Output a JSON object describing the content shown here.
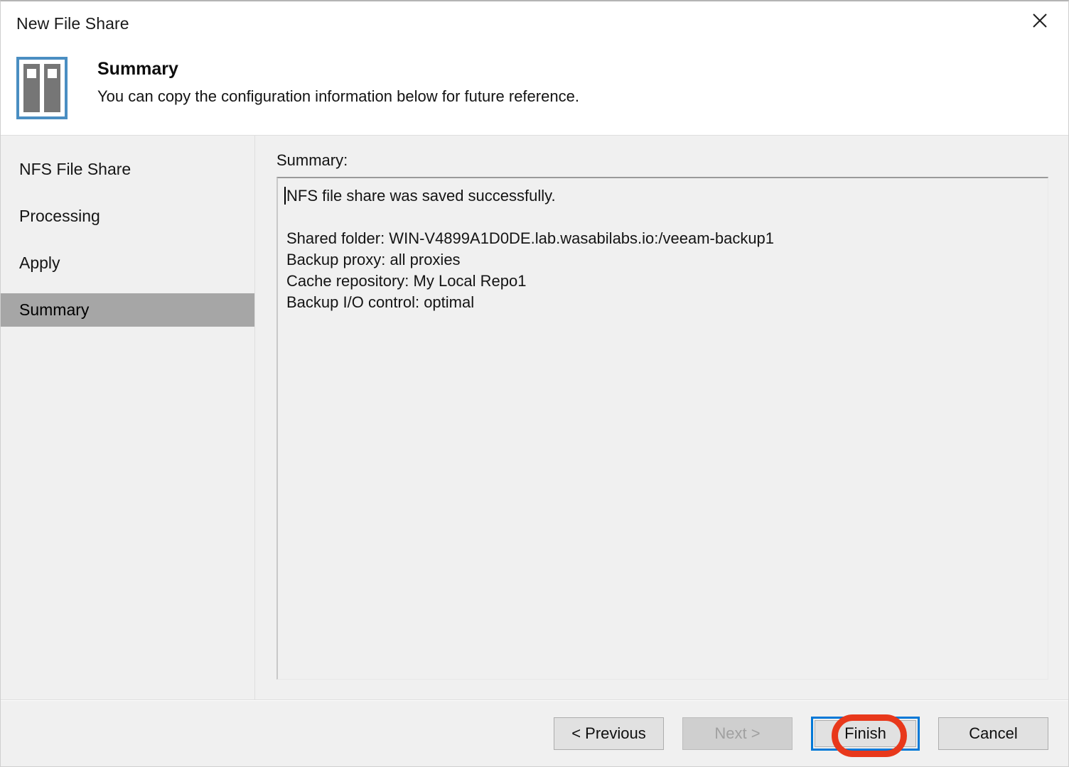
{
  "window": {
    "title": "New File Share",
    "close_icon": "close-icon"
  },
  "header": {
    "icon": "file-share-icon",
    "title": "Summary",
    "subtitle": "You can copy the configuration information below for future reference."
  },
  "sidebar": {
    "items": [
      {
        "label": "NFS File Share",
        "selected": false
      },
      {
        "label": "Processing",
        "selected": false
      },
      {
        "label": "Apply",
        "selected": false
      },
      {
        "label": "Summary",
        "selected": true
      }
    ]
  },
  "content": {
    "summary_label": "Summary:",
    "summary_lines": [
      "NFS file share was saved successfully.",
      "",
      "Shared folder: WIN-V4899A1D0DE.lab.wasabilabs.io:/veeam-backup1",
      "Backup proxy: all proxies",
      "Cache repository: My Local Repo1",
      "Backup I/O control: optimal"
    ]
  },
  "footer": {
    "previous_label": "< Previous",
    "next_label": "Next >",
    "finish_label": "Finish",
    "cancel_label": "Cancel"
  },
  "colors": {
    "accent_blue": "#0078d7",
    "icon_border_blue": "#4a8ec2",
    "selection_gray": "#a6a6a6",
    "annotation_red": "#e8381b",
    "panel_bg": "#f0f0f0"
  }
}
